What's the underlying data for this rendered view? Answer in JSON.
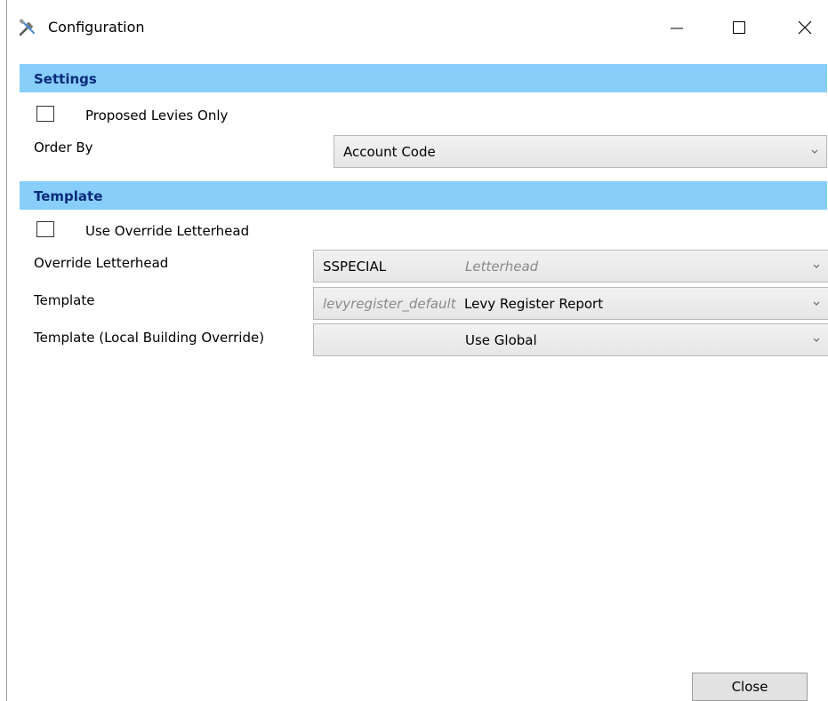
{
  "window": {
    "title": "Configuration",
    "controls": {
      "minimize": "minimize",
      "maximize": "maximize",
      "close": "close"
    }
  },
  "settings": {
    "header": "Settings",
    "proposed_levies_label": "Proposed Levies Only",
    "proposed_levies_checked": false,
    "order_by_label": "Order By",
    "order_by_value": "Account Code"
  },
  "template": {
    "header": "Template",
    "use_override_label": "Use Override Letterhead",
    "use_override_checked": false,
    "override_letterhead_label": "Override Letterhead",
    "override_letterhead_code": "SSPECIAL",
    "override_letterhead_type": "Letterhead",
    "template_label": "Template",
    "template_code": "levyregister_default",
    "template_name": "Levy Register Report",
    "local_override_label": "Template (Local Building Override)",
    "local_override_value": "Use Global"
  },
  "footer": {
    "close_label": "Close"
  },
  "colors": {
    "section_header_bg": "#87cefa",
    "section_header_text": "#0a2a7a"
  },
  "icons": {
    "title": "tools-icon",
    "dropdown": "chevron-down-icon"
  }
}
